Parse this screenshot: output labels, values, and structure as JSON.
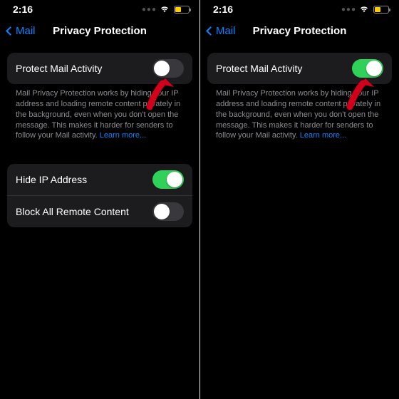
{
  "left": {
    "time": "2:16",
    "back_label": "Mail",
    "title": "Privacy Protection",
    "protect_label": "Protect Mail Activity",
    "footer_text": "Mail Privacy Protection works by hiding your IP address and loading remote content privately in the background, even when you don't open the message. This makes it harder for senders to follow your Mail activity.",
    "learn_more": "Learn more...",
    "hide_ip_label": "Hide IP Address",
    "block_remote_label": "Block All Remote Content"
  },
  "right": {
    "time": "2:16",
    "back_label": "Mail",
    "title": "Privacy Protection",
    "protect_label": "Protect Mail Activity",
    "footer_text": "Mail Privacy Protection works by hiding your IP address and loading remote content privately in the background, even when you don't open the message. This makes it harder for senders to follow your Mail activity.",
    "learn_more": "Learn more..."
  }
}
